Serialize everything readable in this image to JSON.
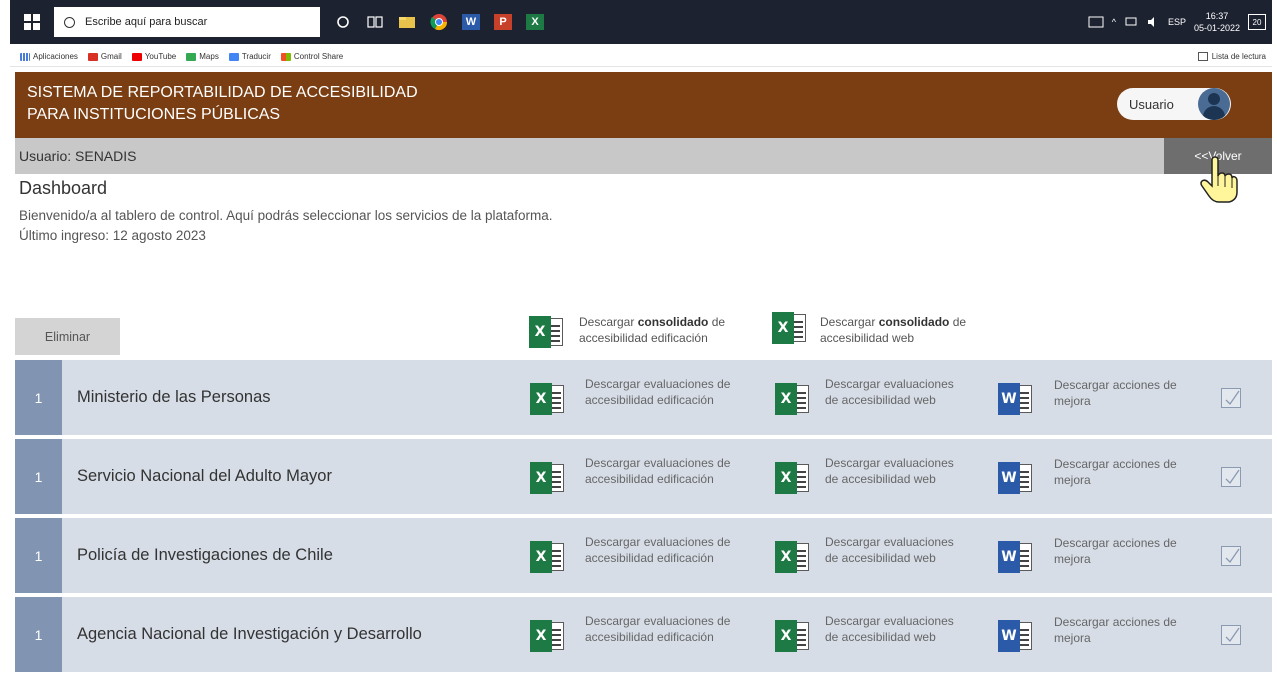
{
  "taskbar": {
    "search_placeholder": "Escribe aquí para buscar",
    "lang": "ESP",
    "time": "16:37",
    "date": "05-01-2022",
    "notifications": "20"
  },
  "bookmarks": {
    "items": [
      "Aplicaciones",
      "Gmail",
      "YouTube",
      "Maps",
      "Traducir",
      "Control Share"
    ],
    "reading_list": "Lista de lectura"
  },
  "header": {
    "title_line1": "SISTEMA DE REPORTABILIDAD DE ACCESIBILIDAD",
    "title_line2": "PARA INSTITUCIONES PÚBLICAS",
    "user_button": "Usuario",
    "accent_color": "#7a3e12"
  },
  "userbar": {
    "user_label": "Usuario: SENADIS",
    "back": "<<Volver"
  },
  "dashboard": {
    "title": "Dashboard",
    "welcome": "Bienvenido/a  al tablero de control. Aquí podrás seleccionar los servicios  de la plataforma.",
    "last_login": "Último ingreso:  12 agosto 2023"
  },
  "actions": {
    "delete": "Eliminar",
    "cons_edif_pre": "Descargar ",
    "cons_edif_bold": "consolidado",
    "cons_edif_post": " de",
    "cons_edif_line2": "accesibilidad edificación",
    "cons_web_pre": "Descargar ",
    "cons_web_bold": "consolidado",
    "cons_web_post": " de",
    "cons_web_line2": "accesibilidad web"
  },
  "row_links": {
    "edif_line1": "Descargar evaluaciones de",
    "edif_line2": "accesibilidad edificación",
    "web_line1": "Descargar evaluaciones",
    "web_line2": "de accesibilidad web",
    "word_line1": "Descargar acciones de",
    "word_line2": "mejora"
  },
  "rows": [
    {
      "num": "1",
      "name": "Ministerio de las Personas"
    },
    {
      "num": "1",
      "name": "Servicio Nacional del Adulto Mayor"
    },
    {
      "num": "1",
      "name": "Policía de Investigaciones de Chile"
    },
    {
      "num": "1",
      "name": "Agencia Nacional de Investigación y Desarrollo"
    }
  ]
}
